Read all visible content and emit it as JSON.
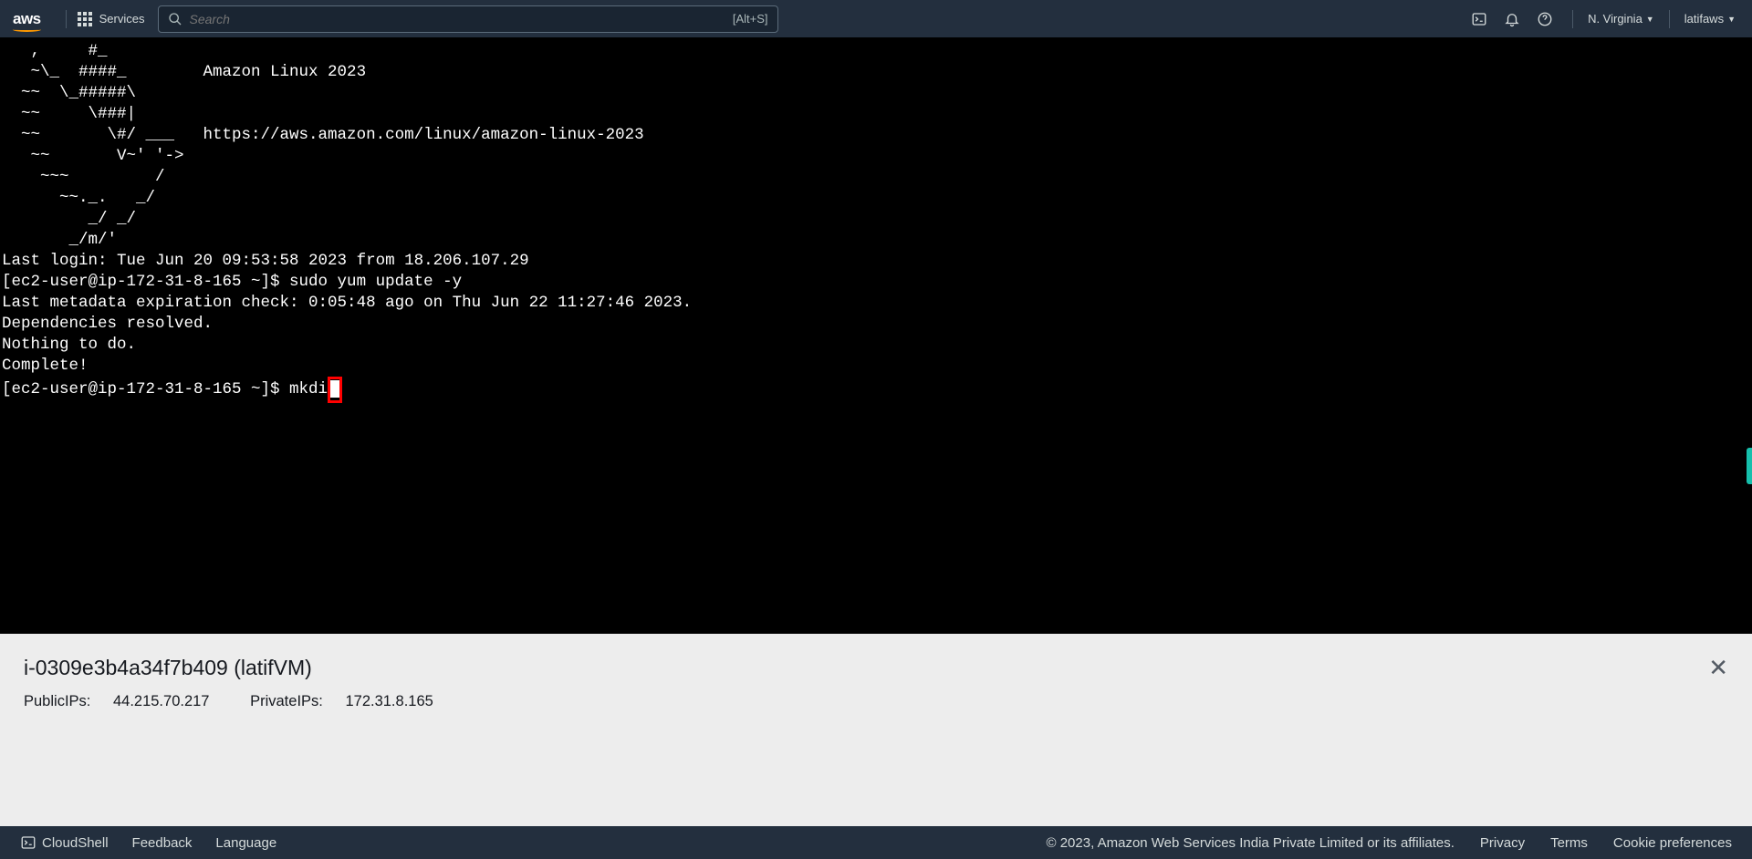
{
  "topbar": {
    "logo": "aws",
    "services_label": "Services",
    "search_placeholder": "Search",
    "search_shortcut": "[Alt+S]",
    "region": "N. Virginia",
    "account": "latifaws"
  },
  "terminal": {
    "ascii_and_output": "   ,     #_\n   ~\\_  ####_        Amazon Linux 2023\n  ~~  \\_#####\\\n  ~~     \\###|\n  ~~       \\#/ ___   https://aws.amazon.com/linux/amazon-linux-2023\n   ~~       V~' '->\n    ~~~         /\n      ~~._.   _/\n         _/ _/\n       _/m/'\nLast login: Tue Jun 20 09:53:58 2023 from 18.206.107.29\n[ec2-user@ip-172-31-8-165 ~]$ sudo yum update -y\nLast metadata expiration check: 0:05:48 ago on Thu Jun 22 11:27:46 2023.\nDependencies resolved.\nNothing to do.\nComplete!\n[ec2-user@ip-172-31-8-165 ~]$ mkdi",
    "current_command": "mkdi"
  },
  "info_panel": {
    "title": "i-0309e3b4a34f7b409 (latifVM)",
    "public_ips_label": "PublicIPs:",
    "public_ips_value": "44.215.70.217",
    "private_ips_label": "PrivateIPs:",
    "private_ips_value": "172.31.8.165"
  },
  "footer": {
    "cloudshell_label": "CloudShell",
    "feedback_label": "Feedback",
    "language_label": "Language",
    "copyright": "© 2023, Amazon Web Services India Private Limited or its affiliates.",
    "privacy": "Privacy",
    "terms": "Terms",
    "cookies": "Cookie preferences"
  }
}
